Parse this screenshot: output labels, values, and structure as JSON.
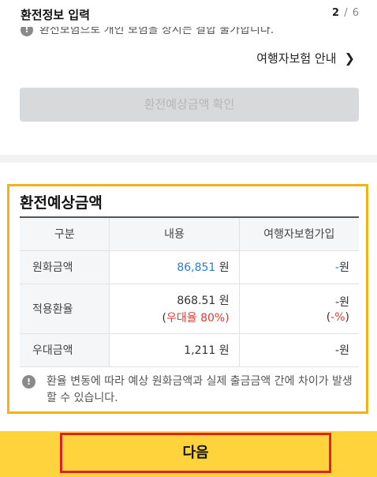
{
  "header": {
    "title": "환전정보 입력",
    "step_current": "2",
    "step_sep": " / ",
    "step_total": "6"
  },
  "top": {
    "clipped_notice": "환전보험으로 개인 보험을 상시는 결합 불가합니다.",
    "insurance_link": "여행자보험 안내",
    "confirm_button": "환전예상금액 확인"
  },
  "result": {
    "title": "환전예상금액",
    "columns": [
      "구분",
      "내용",
      "여행자보험가입"
    ],
    "rows": [
      {
        "label": "원화금액",
        "value": "86,851",
        "value_unit": " 원",
        "ins": "-",
        "ins_unit": "원"
      },
      {
        "label": "적용환율",
        "value": "868.51",
        "value_unit": " 원",
        "sub_open": "(",
        "sub_text": "우대율 80",
        "sub_close": "%)",
        "ins": "-",
        "ins_unit": "원",
        "ins_sub_open": "(",
        "ins_sub_text": "-%",
        "ins_sub_close": ")"
      },
      {
        "label": "우대금액",
        "value": "1,211",
        "value_unit": " 원",
        "ins": "-",
        "ins_unit": "원"
      }
    ],
    "notice": "환율 변동에 따라 예상 원화금액과 실제 출금금액 간에 차이가 발생할 수 있습니다."
  },
  "footer": {
    "next_button": "다음"
  },
  "colors": {
    "accent_yellow": "#ffd33b",
    "highlight_border": "#f2b21b",
    "blue": "#2b7bd6",
    "red": "#e53935",
    "next_outline": "#e01f1f"
  },
  "icons": {
    "info": "info-circle-icon",
    "chevron": "chevron-right-icon"
  }
}
